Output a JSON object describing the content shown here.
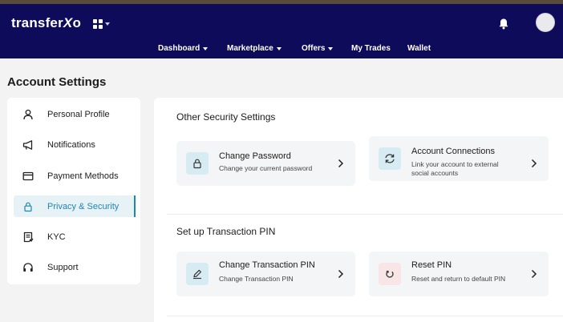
{
  "brand": {
    "name_main": "transfer",
    "name_x": "X",
    "name_o": "o"
  },
  "header": {
    "menu": [
      {
        "label": "Dashboard",
        "dropdown": true
      },
      {
        "label": "Marketplace",
        "dropdown": true
      },
      {
        "label": "Offers",
        "dropdown": true
      },
      {
        "label": "My Trades",
        "dropdown": false
      },
      {
        "label": "Wallet",
        "dropdown": false
      }
    ]
  },
  "page": {
    "title": "Account Settings"
  },
  "sidebar": {
    "items": [
      {
        "label": "Personal Profile",
        "icon": "user-icon",
        "active": false
      },
      {
        "label": "Notifications",
        "icon": "megaphone-icon",
        "active": false
      },
      {
        "label": "Payment Methods",
        "icon": "card-icon",
        "active": false
      },
      {
        "label": "Privacy & Security",
        "icon": "lock-icon",
        "active": true
      },
      {
        "label": "KYC",
        "icon": "id-document-icon",
        "active": false
      },
      {
        "label": "Support",
        "icon": "headset-icon",
        "active": false
      }
    ]
  },
  "security": {
    "title": "Other Security Settings",
    "cards": [
      {
        "title": "Change Password",
        "subtitle": "Change your current password",
        "icon": "lock-icon"
      },
      {
        "title": "Account Connections",
        "subtitle_line1": "Link your account to external",
        "subtitle_line2": "social accounts",
        "icon": "sync-icon"
      }
    ]
  },
  "pin": {
    "title": "Set up Transaction PIN",
    "cards": [
      {
        "title": "Change Transaction PIN",
        "subtitle": "Change Transaction PIN",
        "icon": "pen-icon"
      },
      {
        "title": "Reset PIN",
        "subtitle": "Reset and return to default PIN",
        "icon": "reset-icon"
      }
    ]
  },
  "colors": {
    "nav_bg": "#0d0b5a",
    "accent": "#1f86b2",
    "page_bg": "#f3f3f3",
    "card_bg": "#f4f5f7"
  }
}
